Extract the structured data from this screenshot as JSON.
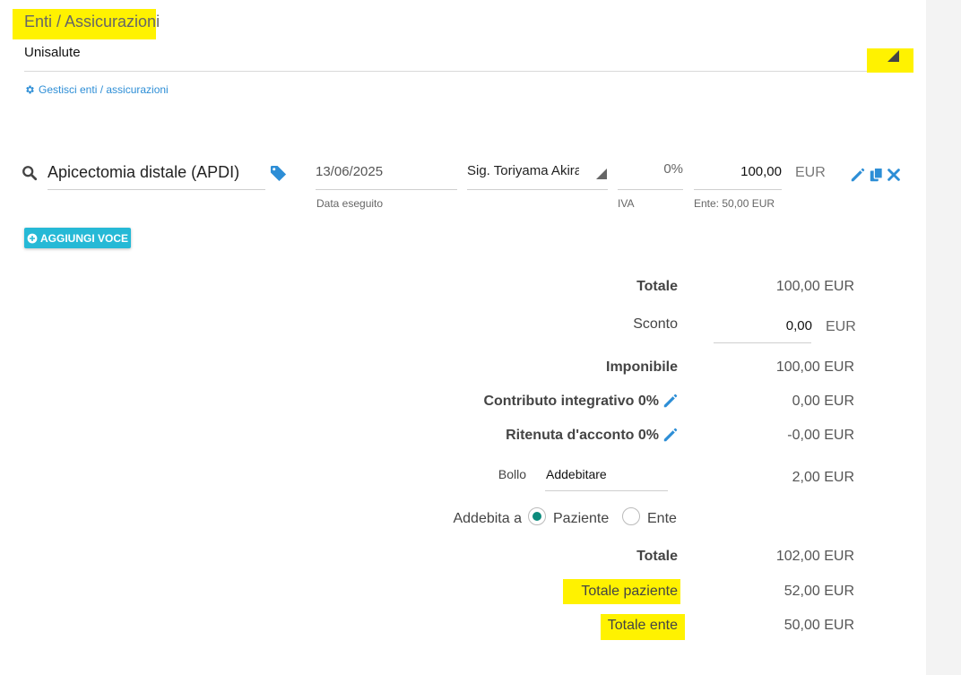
{
  "section": {
    "title": "Enti / Assicurazioni"
  },
  "insurer": {
    "selected": "Unisalute",
    "manage_link": "Gestisci enti / assicurazioni"
  },
  "line_item": {
    "name": "Apicectomia distale (APDI)",
    "date": "13/06/2025",
    "date_label": "Data eseguito",
    "operator": "Sig. Toriyama Akira",
    "vat": "0%",
    "vat_label": "IVA",
    "price": "100,00",
    "currency": "EUR",
    "insurer_share": "Ente: 50,00 EUR"
  },
  "add_button": {
    "label": "AGGIUNGI VOCE"
  },
  "summary": {
    "total_label": "Totale",
    "total_value": "100,00 EUR",
    "discount_label": "Sconto",
    "discount_value": "0,00",
    "discount_currency": "EUR",
    "taxable_label": "Imponibile",
    "taxable_value": "100,00 EUR",
    "contribution_label": "Contributo integrativo 0%",
    "contribution_value": "0,00 EUR",
    "withholding_label": "Ritenuta d'acconto 0%",
    "withholding_value": "-0,00 EUR",
    "stamp_label": "Bollo",
    "stamp_option": "Addebitare",
    "stamp_value": "2,00 EUR",
    "charge_to_label": "Addebita a",
    "charge_patient": "Paziente",
    "charge_insurer": "Ente",
    "grand_total_label": "Totale",
    "grand_total_value": "102,00 EUR",
    "patient_total_label": "Totale paziente",
    "patient_total_value": "52,00 EUR",
    "insurer_total_label": "Totale ente",
    "insurer_total_value": "50,00 EUR"
  },
  "colors": {
    "accent": "#2d8ed6",
    "button": "#26b9d6",
    "radio_selected": "#0c8b7c",
    "highlight": "#fff200"
  }
}
